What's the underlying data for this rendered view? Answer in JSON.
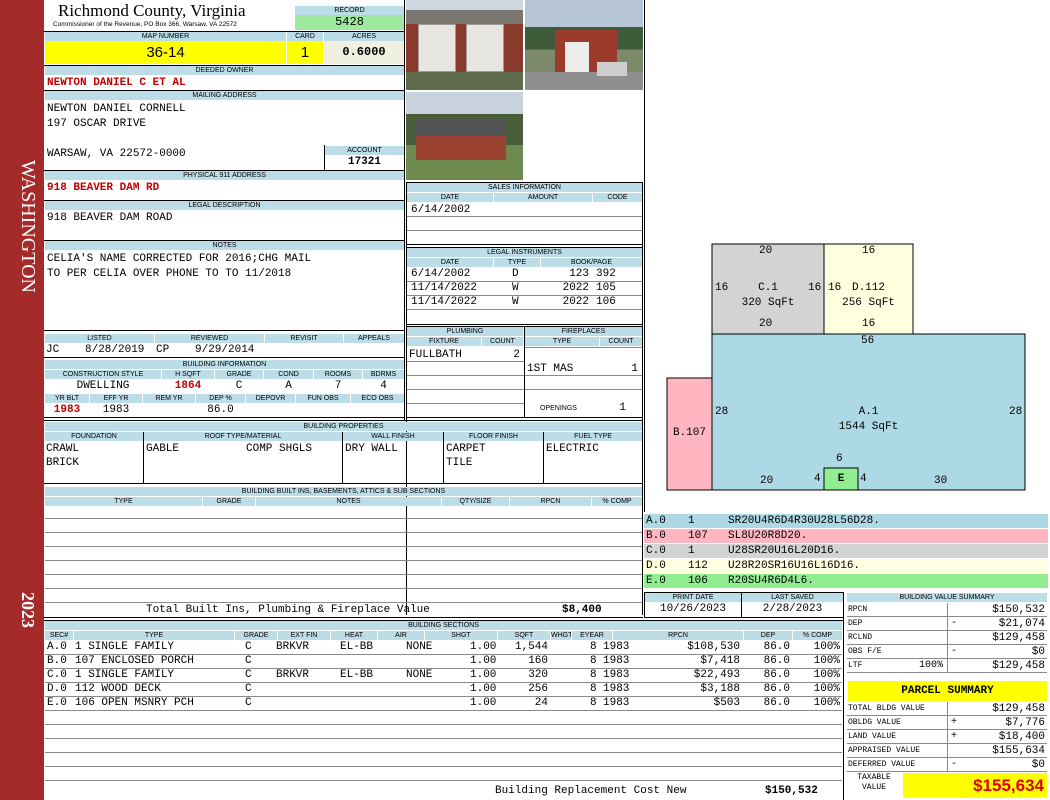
{
  "side": {
    "township": "WASHINGTON",
    "year": "2023"
  },
  "header": {
    "county": "Richmond County, Virginia",
    "commissioner": "Commissioner of the Revenue, PO Box 366, Warsaw, VA 22572"
  },
  "labels": {
    "record": "RECORD",
    "map_number": "MAP NUMBER",
    "card": "CARD",
    "acres": "ACRES",
    "deeded_owner": "DEEDED OWNER",
    "mailing_address": "MAILING ADDRESS",
    "account": "ACCOUNT",
    "physical_address": "PHYSICAL 911 ADDRESS",
    "legal_description": "LEGAL DESCRIPTION",
    "notes": "NOTES",
    "sales_information": "SALES INFORMATION",
    "legal_instruments": "LEGAL INSTRUMENTS",
    "plumbing": "PLUMBING",
    "fireplaces": "FIREPLACES",
    "building_information": "BUILDING INFORMATION",
    "building_properties": "BUILDING PROPERTIES",
    "built_ins": "BUILDING BUILT INS, BASEMENTS, ATTICS & SUB SECTIONS",
    "building_sections": "BUILDING SECTIONS",
    "print_date": "PRINT DATE",
    "last_saved": "LAST SAVED",
    "building_value_summary": "BUILDING VALUE SUMMARY",
    "parcel_summary": "PARCEL SUMMARY",
    "total_built_ins": "Total Built Ins, Plumbing & Fireplace Value",
    "replacement_cost": "Building Replacement Cost New"
  },
  "record": {
    "number": "5428",
    "map_number": "36-14",
    "card": "1",
    "acres": "0.6000"
  },
  "owner": {
    "deeded": "NEWTON DANIEL C ET AL",
    "mail_1": "NEWTON DANIEL CORNELL",
    "mail_2": "197 OSCAR DRIVE",
    "mail_3": "WARSAW, VA 22572-0000",
    "account": "17321"
  },
  "physical_address": "918 BEAVER DAM RD",
  "legal_description": "918 BEAVER DAM ROAD",
  "notes": {
    "line1": "CELIA'S NAME CORRECTED FOR 2016;CHG MAIL",
    "line2": "TO PER CELIA OVER PHONE TO TO 11/2018"
  },
  "sales": {
    "columns": [
      "DATE",
      "AMOUNT",
      "CODE"
    ],
    "rows": [
      {
        "date": "6/14/2002",
        "amount": "",
        "code": ""
      }
    ]
  },
  "instruments": {
    "columns": [
      "DATE",
      "TYPE",
      "BOOK/PAGE"
    ],
    "rows": [
      {
        "date": "6/14/2002",
        "type": "D",
        "book": "123",
        "page": "392"
      },
      {
        "date": "11/14/2022",
        "type": "W",
        "book": "2022",
        "page": "105"
      },
      {
        "date": "11/14/2022",
        "type": "W",
        "book": "2022",
        "page": "106"
      }
    ]
  },
  "plumbing": {
    "columns": [
      "FIXTURE",
      "COUNT"
    ],
    "fixture": "FULLBATH",
    "count": "2"
  },
  "fireplaces": {
    "columns": [
      "TYPE",
      "COUNT"
    ],
    "type": "1ST MAS",
    "count": "1",
    "openings_label": "OPENINGS",
    "openings": "1"
  },
  "review": {
    "columns": [
      "LISTED",
      "REVIEWED",
      "REVISIT",
      "APPEALS"
    ],
    "listed_by": "JC",
    "listed_date": "8/28/2019",
    "reviewed_by": "CP",
    "reviewed_date": "9/29/2014"
  },
  "building_info": {
    "columns": [
      "CONSTRUCTION STYLE",
      "H SQFT",
      "GRADE",
      "COND",
      "ROOMS",
      "BDRMS"
    ],
    "style": "DWELLING",
    "hsqft": "1864",
    "grade": "C",
    "cond": "A",
    "rooms": "7",
    "bdrms": "4",
    "columns2": [
      "YR BLT",
      "EFF YR",
      "REM YR",
      "DEP %",
      "DEPOVR",
      "FUN OBS",
      "ECO OBS"
    ],
    "yr_blt": "1983",
    "eff_yr": "1983",
    "dep": "86.0"
  },
  "properties": {
    "columns": [
      "FOUNDATION",
      "ROOF TYPE/MATERIAL",
      "WALL FINISH",
      "FLOOR FINISH",
      "FUEL TYPE"
    ],
    "foundation": [
      "CRAWL",
      "BRICK"
    ],
    "roof_type": "GABLE",
    "roof_material": "COMP SHGLS",
    "wall": "DRY WALL",
    "floor": [
      "CARPET",
      "TILE"
    ],
    "fuel": "ELECTRIC"
  },
  "built_ins": {
    "columns": [
      "TYPE",
      "GRADE",
      "NOTES",
      "QTY/SIZE",
      "RPCN",
      "% COMP"
    ],
    "total": "$8,400"
  },
  "sketch": {
    "areas": [
      {
        "id": "C.1",
        "sqft": "320 SqFt",
        "color": "#d3d3d3"
      },
      {
        "id": "D.112",
        "sqft": "256 SqFt",
        "color": "#ffffe0"
      },
      {
        "id": "A.1",
        "sqft": "1544 SqFt",
        "color": "#add8e6"
      },
      {
        "id": "B.107",
        "sqft": "",
        "color": "#ffb6c1"
      },
      {
        "id": "E",
        "sqft": "",
        "color": "#90ee90"
      }
    ],
    "dims": [
      "20",
      "16",
      "16",
      "16",
      "16",
      "20",
      "16",
      "56",
      "28",
      "28",
      "6",
      "20",
      "4",
      "4",
      "30"
    ]
  },
  "sketch_legend": [
    {
      "sec": "A.0",
      "code": "1",
      "vector": "SR20U4R6D4R30U28L56D28.",
      "color": "#add8e6"
    },
    {
      "sec": "B.0",
      "code": "107",
      "vector": "SL8U20R8D20.",
      "color": "#ffb6c1"
    },
    {
      "sec": "C.0",
      "code": "1",
      "vector": "U28SR20U16L20D16.",
      "color": "#d3d3d3"
    },
    {
      "sec": "D.0",
      "code": "112",
      "vector": "U28R20SR16U16L16D16.",
      "color": "#ffffe0"
    },
    {
      "sec": "E.0",
      "code": "106",
      "vector": "R20SU4R6D4L6.",
      "color": "#90ee90"
    }
  ],
  "dates": {
    "print_date": "10/26/2023",
    "last_saved": "2/28/2023"
  },
  "value_summary": [
    {
      "label": "RPCN",
      "sign": "",
      "pct": "",
      "value": "$150,532"
    },
    {
      "label": "DEP",
      "sign": "-",
      "pct": "",
      "value": "$21,074"
    },
    {
      "label": "RCLND",
      "sign": "",
      "pct": "",
      "value": "$129,458"
    },
    {
      "label": "OBS F/E",
      "sign": "-",
      "pct": "",
      "value": "$0"
    },
    {
      "label": "LTF",
      "sign": "",
      "pct": "100%",
      "value": "$129,458"
    }
  ],
  "parcel_summary": [
    {
      "label": "TOTAL BLDG VALUE",
      "sign": "",
      "value": "$129,458"
    },
    {
      "label": "OBLDG VALUE",
      "sign": "+",
      "value": "$7,776"
    },
    {
      "label": "LAND VALUE",
      "sign": "+",
      "value": "$18,400"
    },
    {
      "label": "APPRAISED VALUE",
      "sign": "",
      "value": "$155,634"
    },
    {
      "label": "DEFERRED VALUE",
      "sign": "-",
      "value": "$0"
    }
  ],
  "taxable": {
    "label": "TAXABLE VALUE",
    "value": "$155,634"
  },
  "sections": {
    "columns": [
      "SEC#",
      "TYPE",
      "GRADE",
      "EXT FIN",
      "HEAT",
      "AIR",
      "SHGT",
      "SQFT",
      "WHGT",
      "EYEAR",
      "RPCN",
      "DEP",
      "% COMP"
    ],
    "rows": [
      {
        "sec": "A.0",
        "type": "1 SINGLE FAMILY",
        "grade": "C",
        "ext": "BRKVR",
        "heat": "EL-BB",
        "air": "NONE",
        "shgt": "1.00",
        "sqft": "1,544",
        "whgt": "8",
        "eyear": "1983",
        "rpcn": "$108,530",
        "dep": "86.0",
        "comp": "100%"
      },
      {
        "sec": "B.0",
        "type": "107 ENCLOSED PORCH",
        "grade": "C",
        "ext": "",
        "heat": "",
        "air": "",
        "shgt": "1.00",
        "sqft": "160",
        "whgt": "8",
        "eyear": "1983",
        "rpcn": "$7,418",
        "dep": "86.0",
        "comp": "100%"
      },
      {
        "sec": "C.0",
        "type": "1 SINGLE FAMILY",
        "grade": "C",
        "ext": "BRKVR",
        "heat": "EL-BB",
        "air": "NONE",
        "shgt": "1.00",
        "sqft": "320",
        "whgt": "8",
        "eyear": "1983",
        "rpcn": "$22,493",
        "dep": "86.0",
        "comp": "100%"
      },
      {
        "sec": "D.0",
        "type": "112 WOOD DECK",
        "grade": "C",
        "ext": "",
        "heat": "",
        "air": "",
        "shgt": "1.00",
        "sqft": "256",
        "whgt": "8",
        "eyear": "1983",
        "rpcn": "$3,188",
        "dep": "86.0",
        "comp": "100%"
      },
      {
        "sec": "E.0",
        "type": "106 OPEN MSNRY PCH",
        "grade": "C",
        "ext": "",
        "heat": "",
        "air": "",
        "shgt": "1.00",
        "sqft": "24",
        "whgt": "8",
        "eyear": "1983",
        "rpcn": "$503",
        "dep": "86.0",
        "comp": "100%"
      }
    ],
    "replacement_cost": "$150,532"
  }
}
